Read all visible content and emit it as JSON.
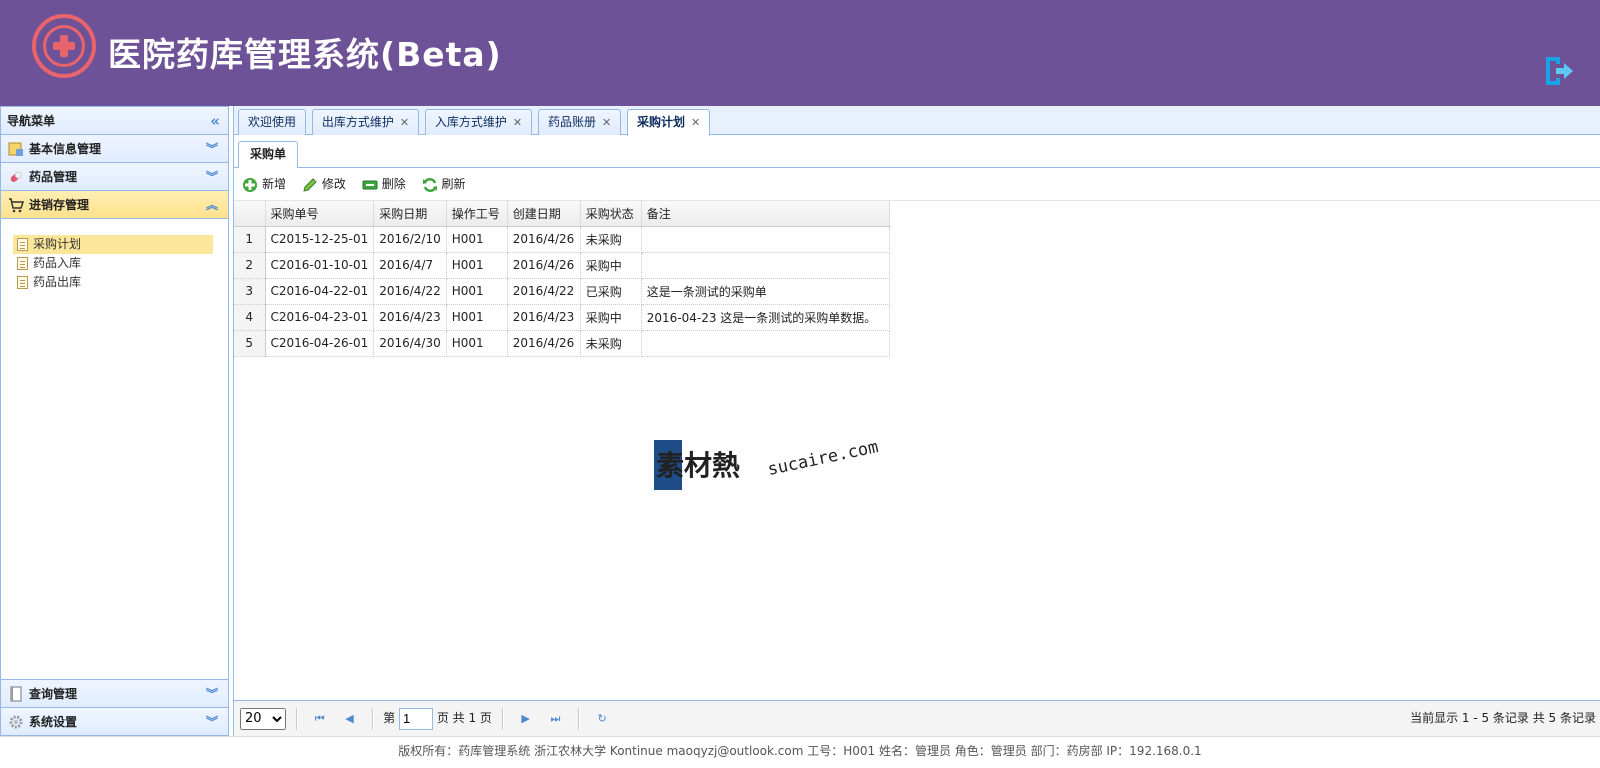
{
  "header": {
    "title": "医院药库管理系统(Beta)"
  },
  "sidebar": {
    "title": "导航菜单",
    "sections": [
      {
        "label": "基本信息管理"
      },
      {
        "label": "药品管理"
      },
      {
        "label": "进销存管理"
      }
    ],
    "tree": [
      {
        "label": "采购计划"
      },
      {
        "label": "药品入库"
      },
      {
        "label": "药品出库"
      }
    ],
    "bottom_sections": [
      {
        "label": "查询管理"
      },
      {
        "label": "系统设置"
      }
    ]
  },
  "tabs": [
    {
      "label": "欢迎使用"
    },
    {
      "label": "出库方式维护"
    },
    {
      "label": "入库方式维护"
    },
    {
      "label": "药品账册"
    },
    {
      "label": "采购计划"
    }
  ],
  "inner_tab": "采购单",
  "toolbar": {
    "add": "新增",
    "edit": "修改",
    "delete": "删除",
    "refresh": "刷新"
  },
  "grid": {
    "columns": [
      "采购单号",
      "采购日期",
      "操作工号",
      "创建日期",
      "采购状态",
      "备注"
    ],
    "rows": [
      {
        "n": "1",
        "id": "C2015-12-25-01",
        "date": "2016/2/10",
        "op": "H001",
        "created": "2016/4/26",
        "status": "未采购",
        "note": ""
      },
      {
        "n": "2",
        "id": "C2016-01-10-01",
        "date": "2016/4/7",
        "op": "H001",
        "created": "2016/4/26",
        "status": "采购中",
        "note": ""
      },
      {
        "n": "3",
        "id": "C2016-04-22-01",
        "date": "2016/4/22",
        "op": "H001",
        "created": "2016/4/22",
        "status": "已采购",
        "note": "这是一条测试的采购单"
      },
      {
        "n": "4",
        "id": "C2016-04-23-01",
        "date": "2016/4/23",
        "op": "H001",
        "created": "2016/4/23",
        "status": "采购中",
        "note": "2016-04-23 这是一条测试的采购单数据。"
      },
      {
        "n": "5",
        "id": "C2016-04-26-01",
        "date": "2016/4/30",
        "op": "H001",
        "created": "2016/4/26",
        "status": "未采购",
        "note": ""
      }
    ]
  },
  "pager": {
    "page_size": "20",
    "page_prefix": "第",
    "page_value": "1",
    "page_suffix": "页 共 1 页",
    "info": "当前显示 1 - 5 条记录 共 5 条记录"
  },
  "watermark": {
    "text": "素材熱",
    "url": "sucaire.com"
  },
  "footer": "版权所有：药库管理系统 浙江农林大学 Kontinue maoqyzj@outlook.com 工号：H001 姓名：管理员 角色：管理员 部门：药房部 IP：192.168.0.1"
}
